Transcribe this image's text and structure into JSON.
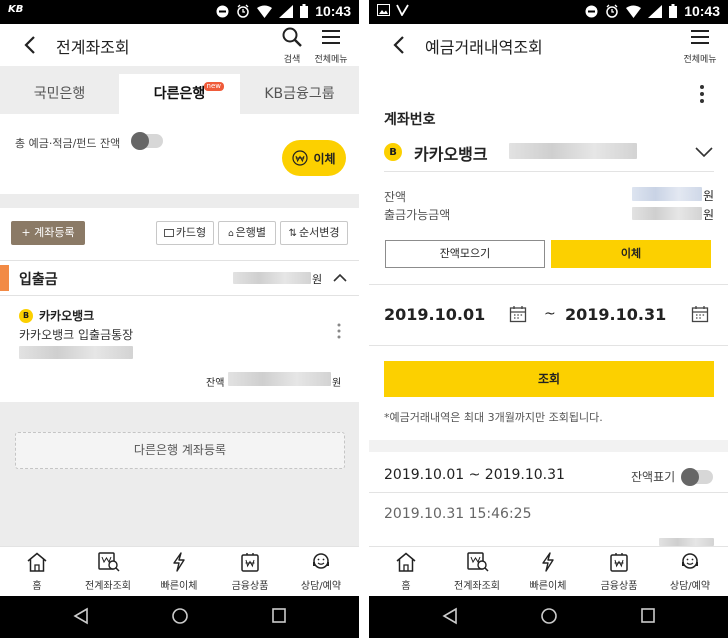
{
  "left": {
    "status": {
      "time": "10:43",
      "app_badge": "KB"
    },
    "header": {
      "title": "전계좌조회",
      "search_label": "검색",
      "menu_label": "전체메뉴"
    },
    "tabs": [
      {
        "label": "국민은행"
      },
      {
        "label": "다른은행",
        "badge": "new"
      },
      {
        "label": "KB금융그룹"
      }
    ],
    "balance": {
      "label": "총 예금·적금/펀드 잔액",
      "transfer_label": "이체"
    },
    "toolbar": {
      "register_label": "+ 계좌등록",
      "card_label": "카드형",
      "bank_label": "은행별",
      "order_label": "순서변경"
    },
    "section": {
      "title": "입출금",
      "currency": "원"
    },
    "account": {
      "bank": "카카오뱅크",
      "product": "카카오뱅크 입출금통장",
      "balance_label": "잔액",
      "currency": "원"
    },
    "register_other_label": "다른은행 계좌등록",
    "nav": [
      {
        "label": "홈",
        "icon": "home-icon"
      },
      {
        "label": "전계좌조회",
        "icon": "account-search-icon"
      },
      {
        "label": "빠른이체",
        "icon": "lightning-icon"
      },
      {
        "label": "금융상품",
        "icon": "product-icon"
      },
      {
        "label": "상담/예약",
        "icon": "consult-icon"
      }
    ]
  },
  "right": {
    "status": {
      "time": "10:43"
    },
    "header": {
      "title": "예금거래내역조회",
      "menu_label": "전체메뉴"
    },
    "account_number_label": "계좌번호",
    "bank": "카카오뱅크",
    "balance_label": "잔액",
    "withdrawable_label": "출금가능금액",
    "currency": "원",
    "collect_balance_label": "잔액모으기",
    "transfer_label": "이체",
    "date_from": "2019.10.01",
    "date_sep": "~",
    "date_to": "2019.10.31",
    "search_label": "조회",
    "notice": "*예금거래내역은 최대 3개월까지만 조회됩니다.",
    "period": "2019.10.01 ~ 2019.10.31",
    "balance_display_label": "잔액표기",
    "txn_time": "2019.10.31 15:46:25",
    "nav": [
      {
        "label": "홈"
      },
      {
        "label": "전계좌조회"
      },
      {
        "label": "빠른이체"
      },
      {
        "label": "금융상품"
      },
      {
        "label": "상담/예약"
      }
    ]
  },
  "colors": {
    "accent_yellow": "#fcd000",
    "brown": "#8b7a66",
    "orange": "#f28a45",
    "badge_red": "#ef5b3a"
  }
}
